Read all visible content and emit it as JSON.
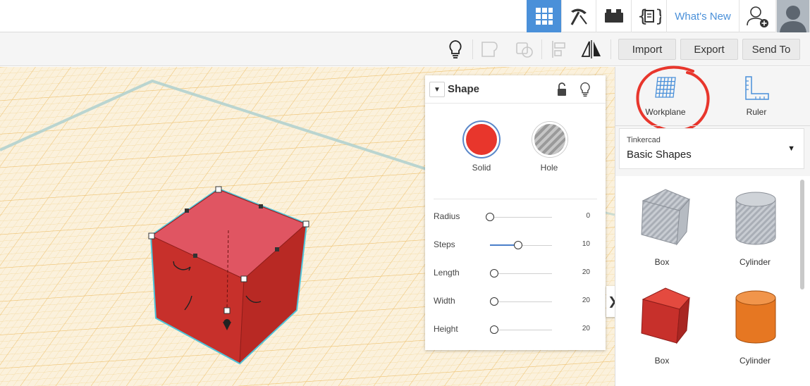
{
  "topbar": {
    "whats_new": "What's New",
    "active_view": "3D Design"
  },
  "toolbar": {
    "import_label": "Import",
    "export_label": "Export",
    "send_to_label": "Send To"
  },
  "inspector": {
    "title": "Shape",
    "solid_label": "Solid",
    "hole_label": "Hole",
    "solid_color": "#e8362c",
    "params": [
      {
        "label": "Radius",
        "value": "0",
        "fraction": 0.0
      },
      {
        "label": "Steps",
        "value": "10",
        "fraction": 0.45
      },
      {
        "label": "Length",
        "value": "20",
        "fraction": 0.07
      },
      {
        "label": "Width",
        "value": "20",
        "fraction": 0.07
      },
      {
        "label": "Height",
        "value": "20",
        "fraction": 0.07
      }
    ]
  },
  "right_panel": {
    "workplane_label": "Workplane",
    "ruler_label": "Ruler",
    "library_category": "Tinkercad",
    "library_name": "Basic Shapes",
    "shapes": [
      {
        "name": "Box",
        "color": "gray"
      },
      {
        "name": "Cylinder",
        "color": "gray"
      },
      {
        "name": "Box",
        "color": "#d9322a"
      },
      {
        "name": "Cylinder",
        "color": "#e67722"
      }
    ]
  },
  "colors": {
    "accent": "#4a90d9",
    "workplane": "#fbf1dc",
    "selection": "#4fc3d9",
    "annotation": "#e8362c"
  }
}
